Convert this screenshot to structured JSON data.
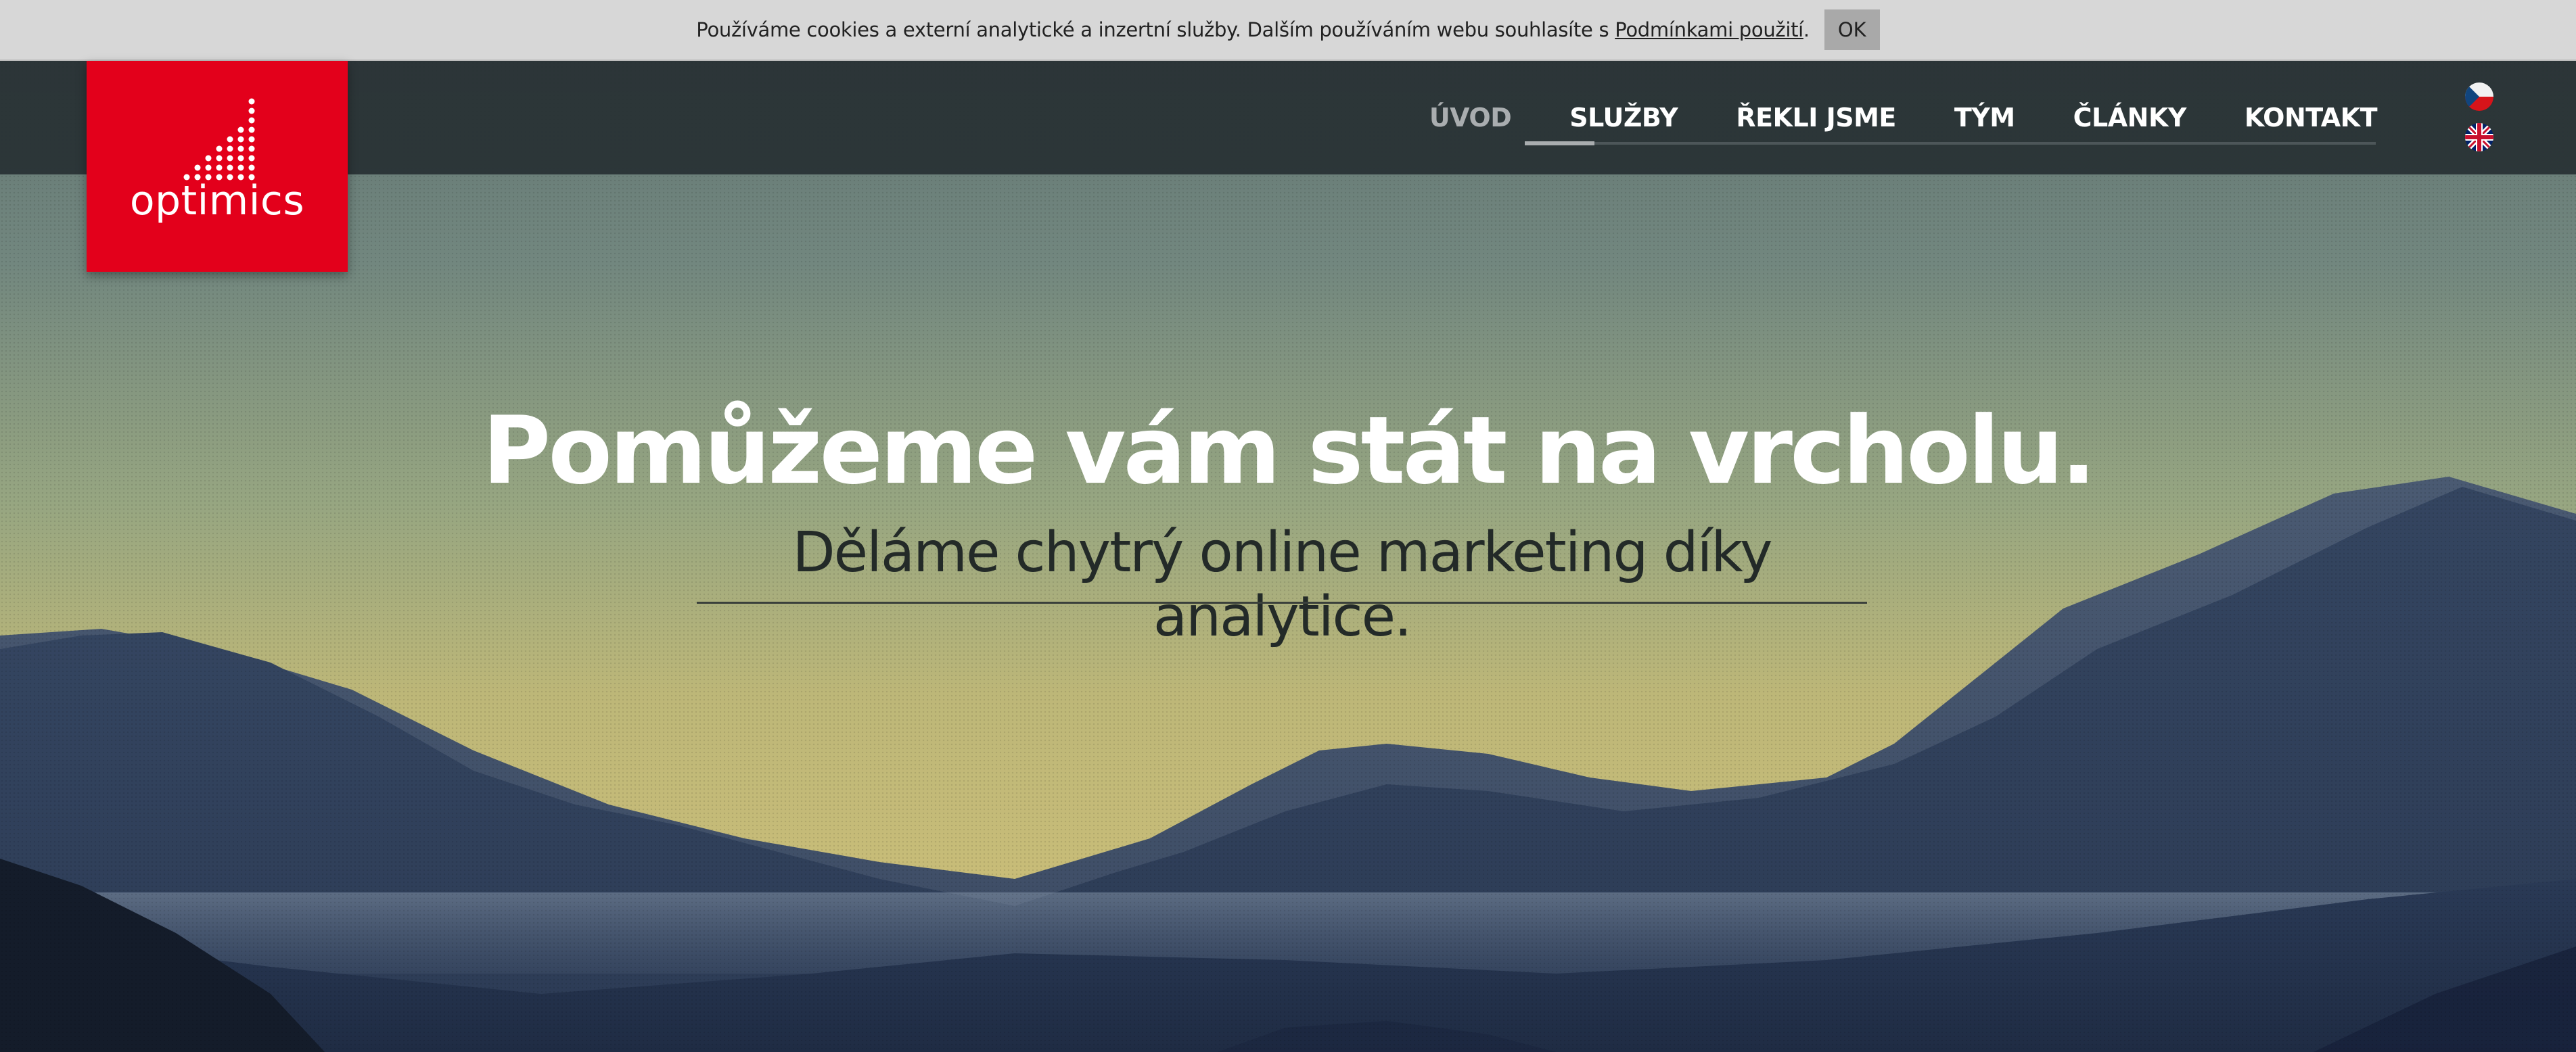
{
  "cookie_bar": {
    "text": "Používáme cookies a externí analytické a inzertní služby. Dalším používáním webu souhlasíte s ",
    "link": "Podmínkami použití",
    "suffix": ".",
    "ok_label": "OK"
  },
  "logo": {
    "text": "optimics",
    "icon": "signal-dots-logo-icon",
    "color": "#e3001b"
  },
  "nav": {
    "items": [
      {
        "label": "ÚVOD",
        "active": true
      },
      {
        "label": "SLUŽBY",
        "active": false
      },
      {
        "label": "ŘEKLI JSME",
        "active": false
      },
      {
        "label": "TÝM",
        "active": false
      },
      {
        "label": "ČLÁNKY",
        "active": false
      },
      {
        "label": "KONTAKT",
        "active": false
      }
    ],
    "languages": [
      {
        "icon": "czech-flag-icon"
      },
      {
        "icon": "uk-flag-icon"
      }
    ]
  },
  "hero": {
    "title": "Pomůžeme vám stát na vrcholu.",
    "subtitle": "Děláme chytrý online marketing díky analytice."
  },
  "colors": {
    "brand_red": "#e3001b",
    "nav_bg": "#283034",
    "cookie_bg": "#d7d7d7"
  }
}
